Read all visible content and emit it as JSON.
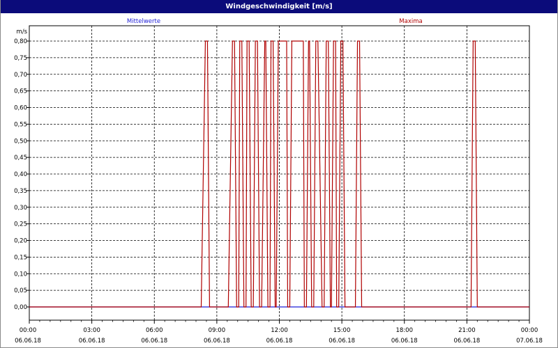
{
  "window": {
    "title": "Windgeschwindigkeit [m/s]"
  },
  "colors": {
    "mean": "#1f1fd6",
    "max": "#b00000",
    "grid": "#000000",
    "titlebar": "#0b0b7a"
  },
  "chart_data": {
    "type": "line",
    "title": "Windgeschwindigkeit [m/s]",
    "ylabel": "m/s",
    "xlabel": "",
    "ylim": [
      0,
      0.85
    ],
    "xlim_hours": [
      0,
      24
    ],
    "yticks": [
      "0,00",
      "0,05",
      "0,10",
      "0,15",
      "0,20",
      "0,25",
      "0,30",
      "0,35",
      "0,40",
      "0,45",
      "0,50",
      "0,55",
      "0,60",
      "0,65",
      "0,70",
      "0,75",
      "0,80"
    ],
    "xticks": [
      {
        "time": "00:00",
        "date": "06.06.18"
      },
      {
        "time": "03:00",
        "date": "06.06.18"
      },
      {
        "time": "06:00",
        "date": "06.06.18"
      },
      {
        "time": "09:00",
        "date": "06.06.18"
      },
      {
        "time": "12:00",
        "date": "06.06.18"
      },
      {
        "time": "15:00",
        "date": "06.06.18"
      },
      {
        "time": "18:00",
        "date": "06.06.18"
      },
      {
        "time": "21:00",
        "date": "06.06.18"
      },
      {
        "time": "00:00",
        "date": "07.06.18"
      }
    ],
    "grid": true,
    "legend": "top",
    "series": [
      {
        "name": "Mittelwerte",
        "color": "#1f1fd6",
        "x": [
          0,
          24
        ],
        "y": [
          0,
          0
        ]
      },
      {
        "name": "Maxima",
        "color": "#b00000",
        "x": [
          0,
          8.25,
          8.45,
          8.55,
          8.65,
          8.75,
          9.55,
          9.75,
          9.85,
          9.95,
          10.05,
          10.1,
          10.2,
          10.3,
          10.4,
          10.45,
          10.55,
          10.65,
          10.75,
          10.85,
          10.95,
          11.05,
          11.15,
          11.3,
          11.35,
          11.45,
          11.55,
          11.6,
          11.7,
          11.8,
          11.85,
          11.95,
          12.05,
          12.2,
          12.35,
          12.4,
          12.5,
          12.6,
          12.95,
          13.05,
          13.15,
          13.2,
          13.3,
          13.4,
          13.45,
          13.55,
          13.65,
          13.75,
          13.85,
          14.05,
          14.15,
          14.25,
          14.35,
          14.45,
          14.5,
          14.6,
          14.7,
          14.75,
          14.85,
          14.95,
          15.05,
          15.15,
          15.65,
          15.75,
          15.85,
          15.95,
          21.2,
          21.3,
          21.4,
          21.5,
          24
        ],
        "y": [
          0,
          0,
          0.8,
          0.8,
          0,
          0,
          0,
          0.8,
          0.8,
          0,
          0,
          0.8,
          0.8,
          0,
          0,
          0.8,
          0.8,
          0,
          0,
          0.8,
          0.8,
          0,
          0,
          0.8,
          0.8,
          0,
          0,
          0.8,
          0.8,
          0,
          0,
          0.8,
          0.8,
          0.8,
          0.8,
          0,
          0,
          0.8,
          0.8,
          0.8,
          0.8,
          0,
          0,
          0.8,
          0.8,
          0,
          0,
          0.8,
          0.8,
          0,
          0,
          0.8,
          0.8,
          0,
          0,
          0.8,
          0.8,
          0,
          0,
          0.8,
          0.8,
          0,
          0,
          0.8,
          0.8,
          0,
          0,
          0.8,
          0.8,
          0,
          0
        ]
      }
    ]
  }
}
